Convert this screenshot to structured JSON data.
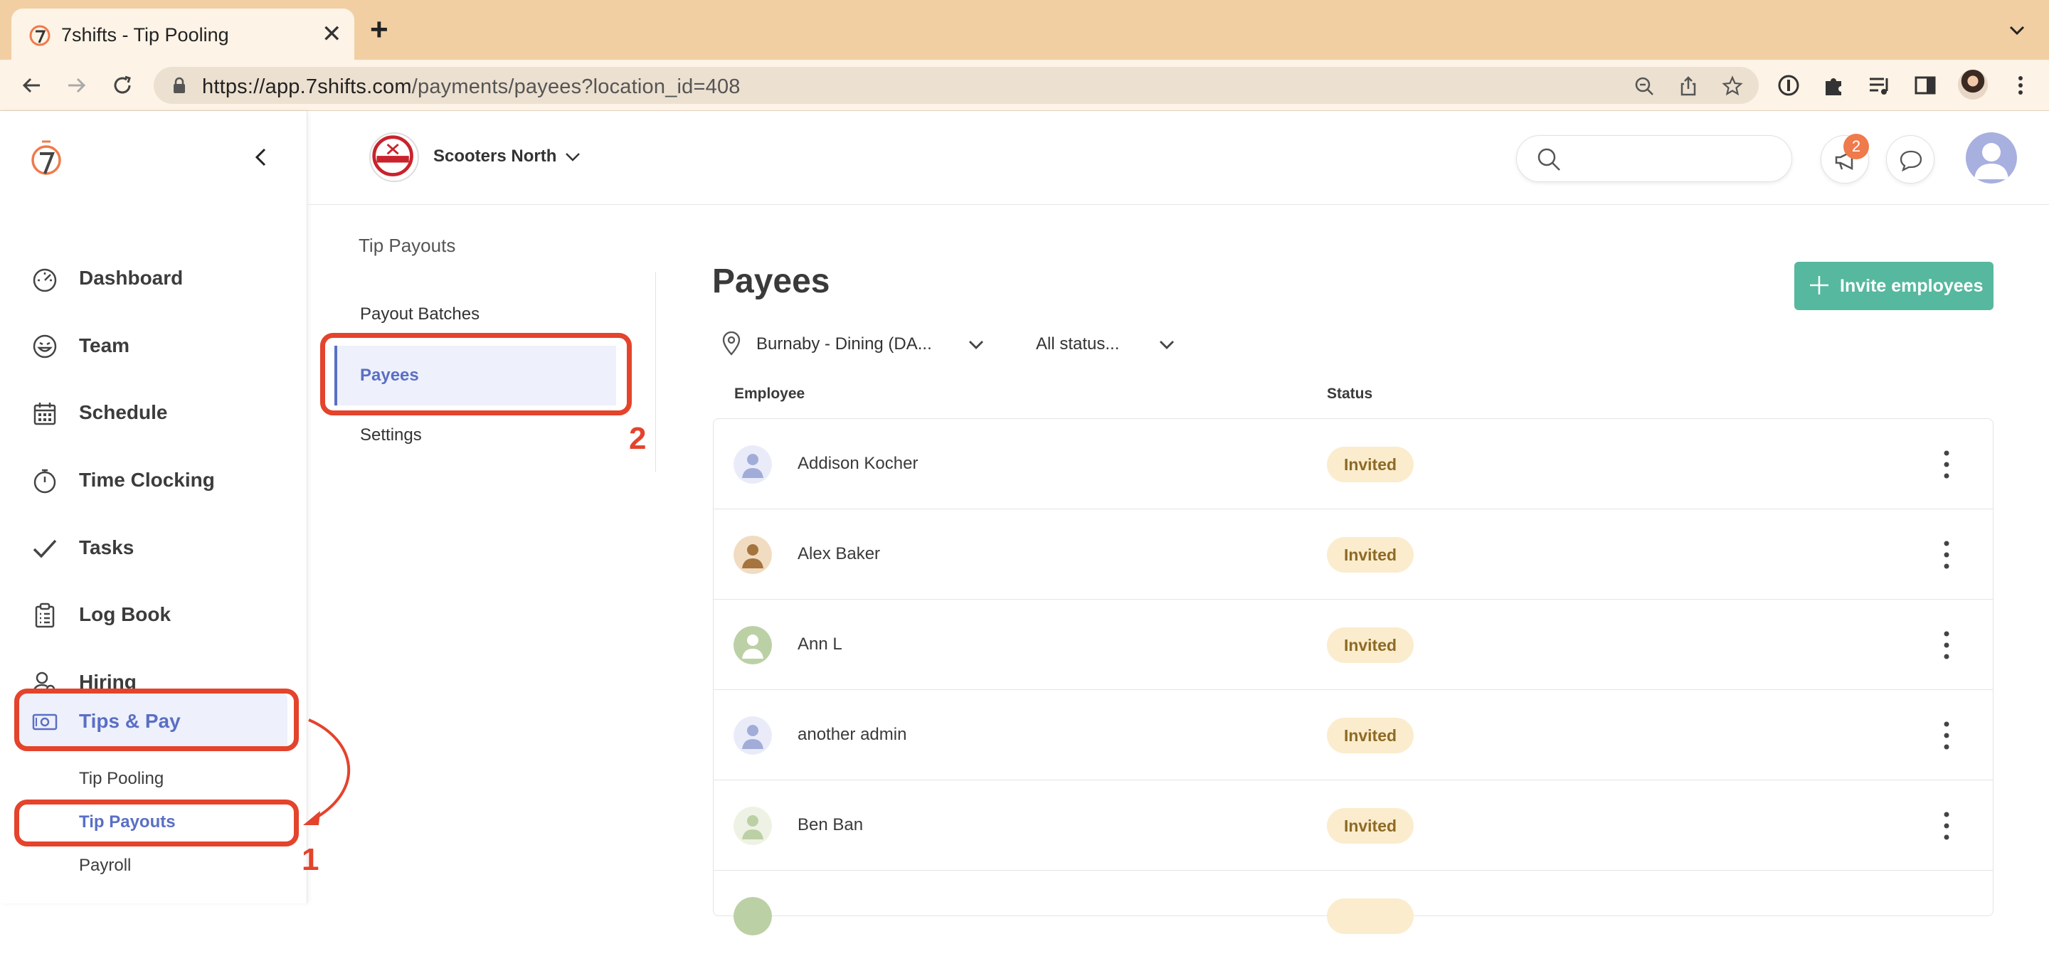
{
  "browser": {
    "tab_title": "7shifts - Tip Pooling",
    "url_host": "https://app.7shifts.com",
    "url_path": "/payments/payees?location_id=408"
  },
  "sidebar": {
    "items": [
      {
        "label": "Dashboard",
        "icon": "dashboard-gauge-icon"
      },
      {
        "label": "Team",
        "icon": "smiley-icon"
      },
      {
        "label": "Schedule",
        "icon": "calendar-icon"
      },
      {
        "label": "Time Clocking",
        "icon": "stopwatch-icon"
      },
      {
        "label": "Tasks",
        "icon": "checkmark-icon"
      },
      {
        "label": "Log Book",
        "icon": "clipboard-icon"
      },
      {
        "label": "Hiring",
        "icon": "person-search-icon"
      },
      {
        "label": "Tips & Pay",
        "icon": "money-icon"
      }
    ],
    "sub_items": [
      "Tip Pooling",
      "Tip Payouts",
      "Payroll"
    ]
  },
  "header": {
    "location_name": "Scooters North",
    "notification_count": "2"
  },
  "secondary_nav": {
    "title": "Tip Payouts",
    "items": [
      "Payout Batches",
      "Payees",
      "Settings"
    ]
  },
  "main": {
    "title": "Payees",
    "invite_button": "Invite employees",
    "filter_location": "Burnaby - Dining (DA...",
    "filter_status": "All status...",
    "columns": [
      "Employee",
      "Status"
    ],
    "rows": [
      {
        "name": "Addison Kocher",
        "status": "Invited"
      },
      {
        "name": "Alex Baker",
        "status": "Invited"
      },
      {
        "name": "Ann L",
        "status": "Invited"
      },
      {
        "name": "another admin",
        "status": "Invited"
      },
      {
        "name": "Ben Ban",
        "status": "Invited"
      }
    ]
  },
  "annotations": {
    "step1": "1",
    "step2": "2"
  },
  "colors": {
    "accent": "#5a6fc4",
    "primary_button": "#56b89e",
    "annotation": "#e4432c",
    "badge_bg": "#fbeccd"
  }
}
